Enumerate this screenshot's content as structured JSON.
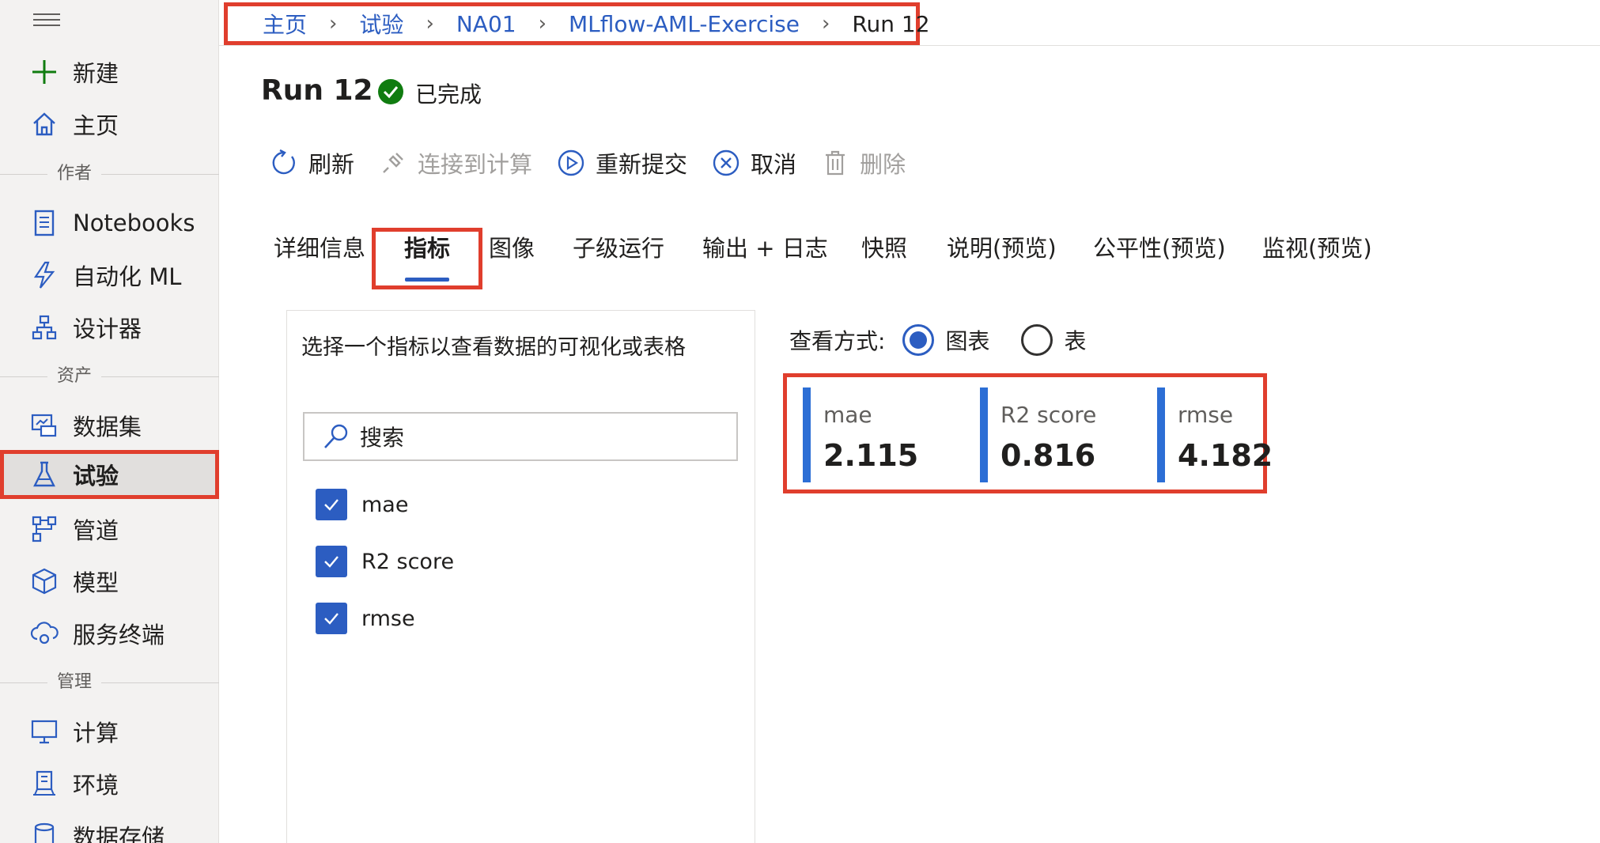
{
  "sidebar": {
    "new_label": "新建",
    "home_label": "主页",
    "section_author": "作者",
    "notebooks_label": "Notebooks",
    "automl_label": "自动化 ML",
    "designer_label": "设计器",
    "section_assets": "资产",
    "datasets_label": "数据集",
    "experiments_label": "试验",
    "pipelines_label": "管道",
    "models_label": "模型",
    "endpoints_label": "服务终端",
    "section_manage": "管理",
    "compute_label": "计算",
    "environments_label": "环境",
    "datastores_label": "数据存储"
  },
  "breadcrumb": {
    "home": "主页",
    "experiments": "试验",
    "workspace": "NA01",
    "experiment": "MLflow-AML-Exercise",
    "current": "Run 12"
  },
  "run": {
    "title": "Run 12",
    "status": "已完成"
  },
  "toolbar": {
    "refresh": "刷新",
    "connect": "连接到计算",
    "resubmit": "重新提交",
    "cancel": "取消",
    "delete": "删除"
  },
  "tabs": {
    "details": "详细信息",
    "metrics": "指标",
    "images": "图像",
    "child_runs": "子级运行",
    "outputs": "输出 + 日志",
    "snapshot": "快照",
    "explanations": "说明(预览)",
    "fairness": "公平性(预览)",
    "monitoring": "监视(预览)"
  },
  "metrics_panel": {
    "hint": "选择一个指标以查看数据的可视化或表格",
    "search_placeholder": "搜索",
    "items": [
      "mae",
      "R2 score",
      "rmse"
    ]
  },
  "view_as": {
    "label": "查看方式:",
    "chart": "图表",
    "table": "表"
  },
  "cards": [
    {
      "name": "mae",
      "value": "2.115"
    },
    {
      "name": "R2 score",
      "value": "0.816"
    },
    {
      "name": "rmse",
      "value": "4.182"
    }
  ],
  "colors": {
    "accent": "#2c5dc1",
    "highlight": "#e03e2d",
    "success": "#107c10"
  }
}
